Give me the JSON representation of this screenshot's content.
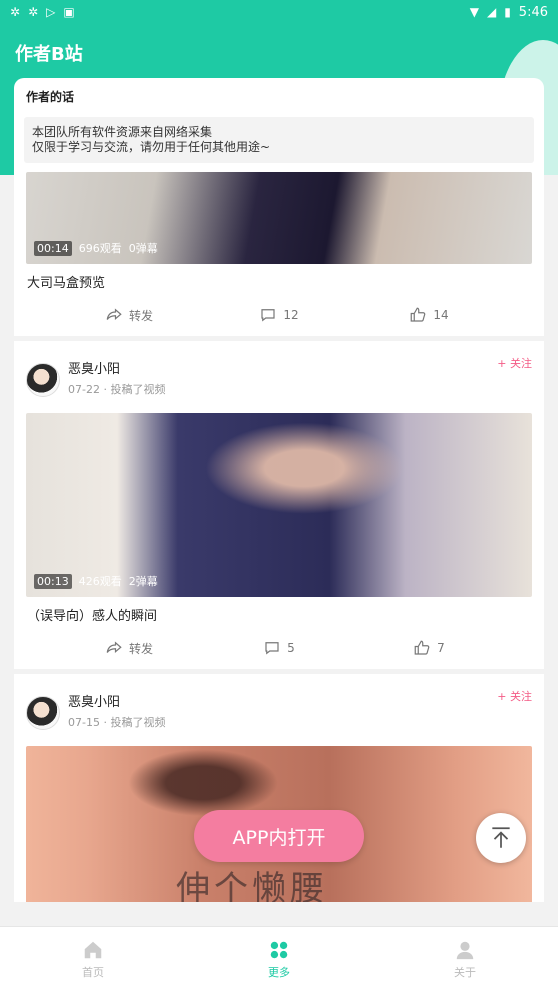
{
  "status_bar": {
    "left_icons": [
      "bug-icon",
      "bug-icon",
      "play-store-icon",
      "a-icon"
    ],
    "time": "5:46"
  },
  "header": {
    "title": "作者B站"
  },
  "note": {
    "title": "作者的话",
    "line1": "本团队所有软件资源来自网络采集",
    "line2": "仅限于学习与交流，请勿用于任何其他用途~"
  },
  "posts": [
    {
      "author": "",
      "date": "",
      "duration": "00:14",
      "views": "696观看",
      "danmaku": "0弹幕",
      "caption": "大司马盒预览",
      "share_label": "转发",
      "comments": "12",
      "likes": "14"
    },
    {
      "author": "恶臭小阳",
      "date": "07-22 · 投稿了视频",
      "follow": "+ 关注",
      "duration": "00:13",
      "views": "426观看",
      "danmaku": "2弹幕",
      "caption": "（误导向）感人的瞬间",
      "share_label": "转发",
      "comments": "5",
      "likes": "7"
    },
    {
      "author": "恶臭小阳",
      "date": "07-15 · 投稿了视频",
      "follow": "+ 关注",
      "overlay_text": "伸个懒腰"
    }
  ],
  "floating": {
    "open_app": "APP内打开"
  },
  "bottom_nav": {
    "home": "首页",
    "more": "更多",
    "about": "关于"
  },
  "colors": {
    "accent": "#1ecaa4",
    "pink": "#f45c86",
    "button_pink": "#f47da0"
  }
}
